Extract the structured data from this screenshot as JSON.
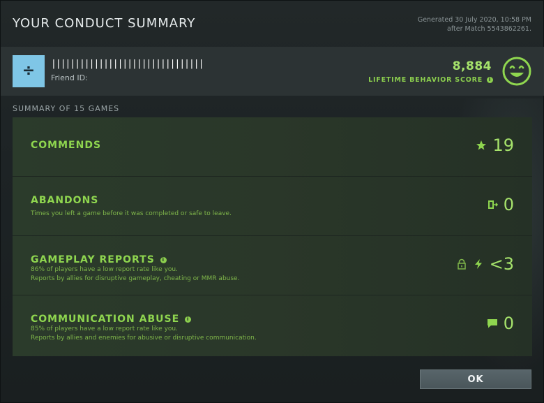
{
  "header": {
    "title": "YOUR CONDUCT SUMMARY",
    "generated_line1": "Generated 30 July 2020, 10:58 PM",
    "generated_line2": "after Match 5543862261."
  },
  "profile": {
    "player_name": "||||||||||||||||||||||||||||||||",
    "friend_id_label": "Friend ID:",
    "behavior_score": "8,884",
    "behavior_score_label": "LIFETIME BEHAVIOR SCORE",
    "avatar_icon": "divide-icon"
  },
  "summary": {
    "heading": "SUMMARY OF 15 GAMES",
    "commends": {
      "title": "COMMENDS",
      "value": "19",
      "icon": "star-icon"
    },
    "abandons": {
      "title": "ABANDONS",
      "subtitle": "Times you left a game before it was completed or safe to leave.",
      "value": "0",
      "icon": "exit-door-icon"
    },
    "gameplay_reports": {
      "title": "GAMEPLAY REPORTS",
      "subtitle1": "86% of players have a low report rate like you.",
      "subtitle2": "Reports by allies for disruptive gameplay, cheating or MMR abuse.",
      "value": "<3",
      "icon": "lightning-icon"
    },
    "communication_abuse": {
      "title": "COMMUNICATION ABUSE",
      "subtitle1": "85% of players have a low report rate like you.",
      "subtitle2": "Reports by allies and enemies for abusive or disruptive communication.",
      "value": "0",
      "icon": "chat-bubble-icon"
    }
  },
  "footer": {
    "ok_label": "OK"
  },
  "colors": {
    "accent_green": "#8fd64f",
    "value_green": "#a6e36b",
    "card_bg": "#2b3b2b"
  }
}
